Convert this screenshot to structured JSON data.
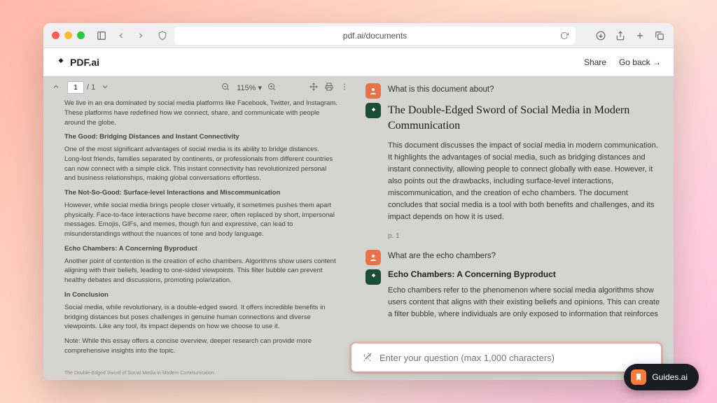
{
  "browser": {
    "url": "pdf.ai/documents"
  },
  "app": {
    "brand": "PDF.ai",
    "share_label": "Share",
    "back_label": "Go back →"
  },
  "pdf_toolbar": {
    "page_current": "1",
    "page_total": "/ 1",
    "zoom": "115% ▾"
  },
  "pdf_doc": {
    "intro": "We live in an era dominated by social media platforms like Facebook, Twitter, and Instagram. These platforms have redefined how we connect, share, and communicate with people around the globe.",
    "h1": "The Good: Bridging Distances and Instant Connectivity",
    "p1": "One of the most significant advantages of social media is its ability to bridge distances. Long-lost friends, families separated by continents, or professionals from different countries can now connect with a simple click. This instant connectivity has revolutionized personal and business relationships, making global conversations effortless.",
    "h2": "The Not-So-Good: Surface-level Interactions and Miscommunication",
    "p2": "However, while social media brings people closer virtually, it sometimes pushes them apart physically. Face-to-face interactions have become rarer, often replaced by short, impersonal messages. Emojis, GIFs, and memes, though fun and expressive, can lead to misunderstandings without the nuances of tone and body language.",
    "h3": "Echo Chambers: A Concerning Byproduct",
    "p3": "Another point of contention is the creation of echo chambers. Algorithms show users content aligning with their beliefs, leading to one-sided viewpoints. This filter bubble can prevent healthy debates and discussions, promoting polarization.",
    "h4": "In Conclusion",
    "p4": "Social media, while revolutionary, is a double-edged sword. It offers incredible benefits in bridging distances but poses challenges in genuine human connections and diverse viewpoints. Like any tool, its impact depends on how we choose to use it.",
    "note": "Note: While this essay offers a concise overview, deeper research can provide more comprehensive insights into the topic.",
    "footer": "The Double-Edged Sword of Social Media in Modern Communication"
  },
  "chat": {
    "q1": "What is this document about?",
    "a1_title": "The Double-Edged Sword of Social Media in Modern Communication",
    "a1_body": "This document discusses the impact of social media in modern communication. It highlights the advantages of social media, such as bridging distances and instant connectivity, allowing people to connect globally with ease. However, it also points out the drawbacks, including surface-level interactions, miscommunication, and the creation of echo chambers. The document concludes that social media is a tool with both benefits and challenges, and its impact depends on how it is used.",
    "a1_page": "p. 1",
    "q2": "What are the echo chambers?",
    "a2_title": "Echo Chambers: A Concerning Byproduct",
    "a2_body": "Echo chambers refer to the phenomenon where social media algorithms show users content that aligns with their existing beliefs and opinions. This can create a filter bubble, where individuals are only exposed to information that reinforces"
  },
  "input": {
    "placeholder": "Enter your question (max 1,000 characters)"
  },
  "badge": {
    "label": "Guides.ai"
  }
}
